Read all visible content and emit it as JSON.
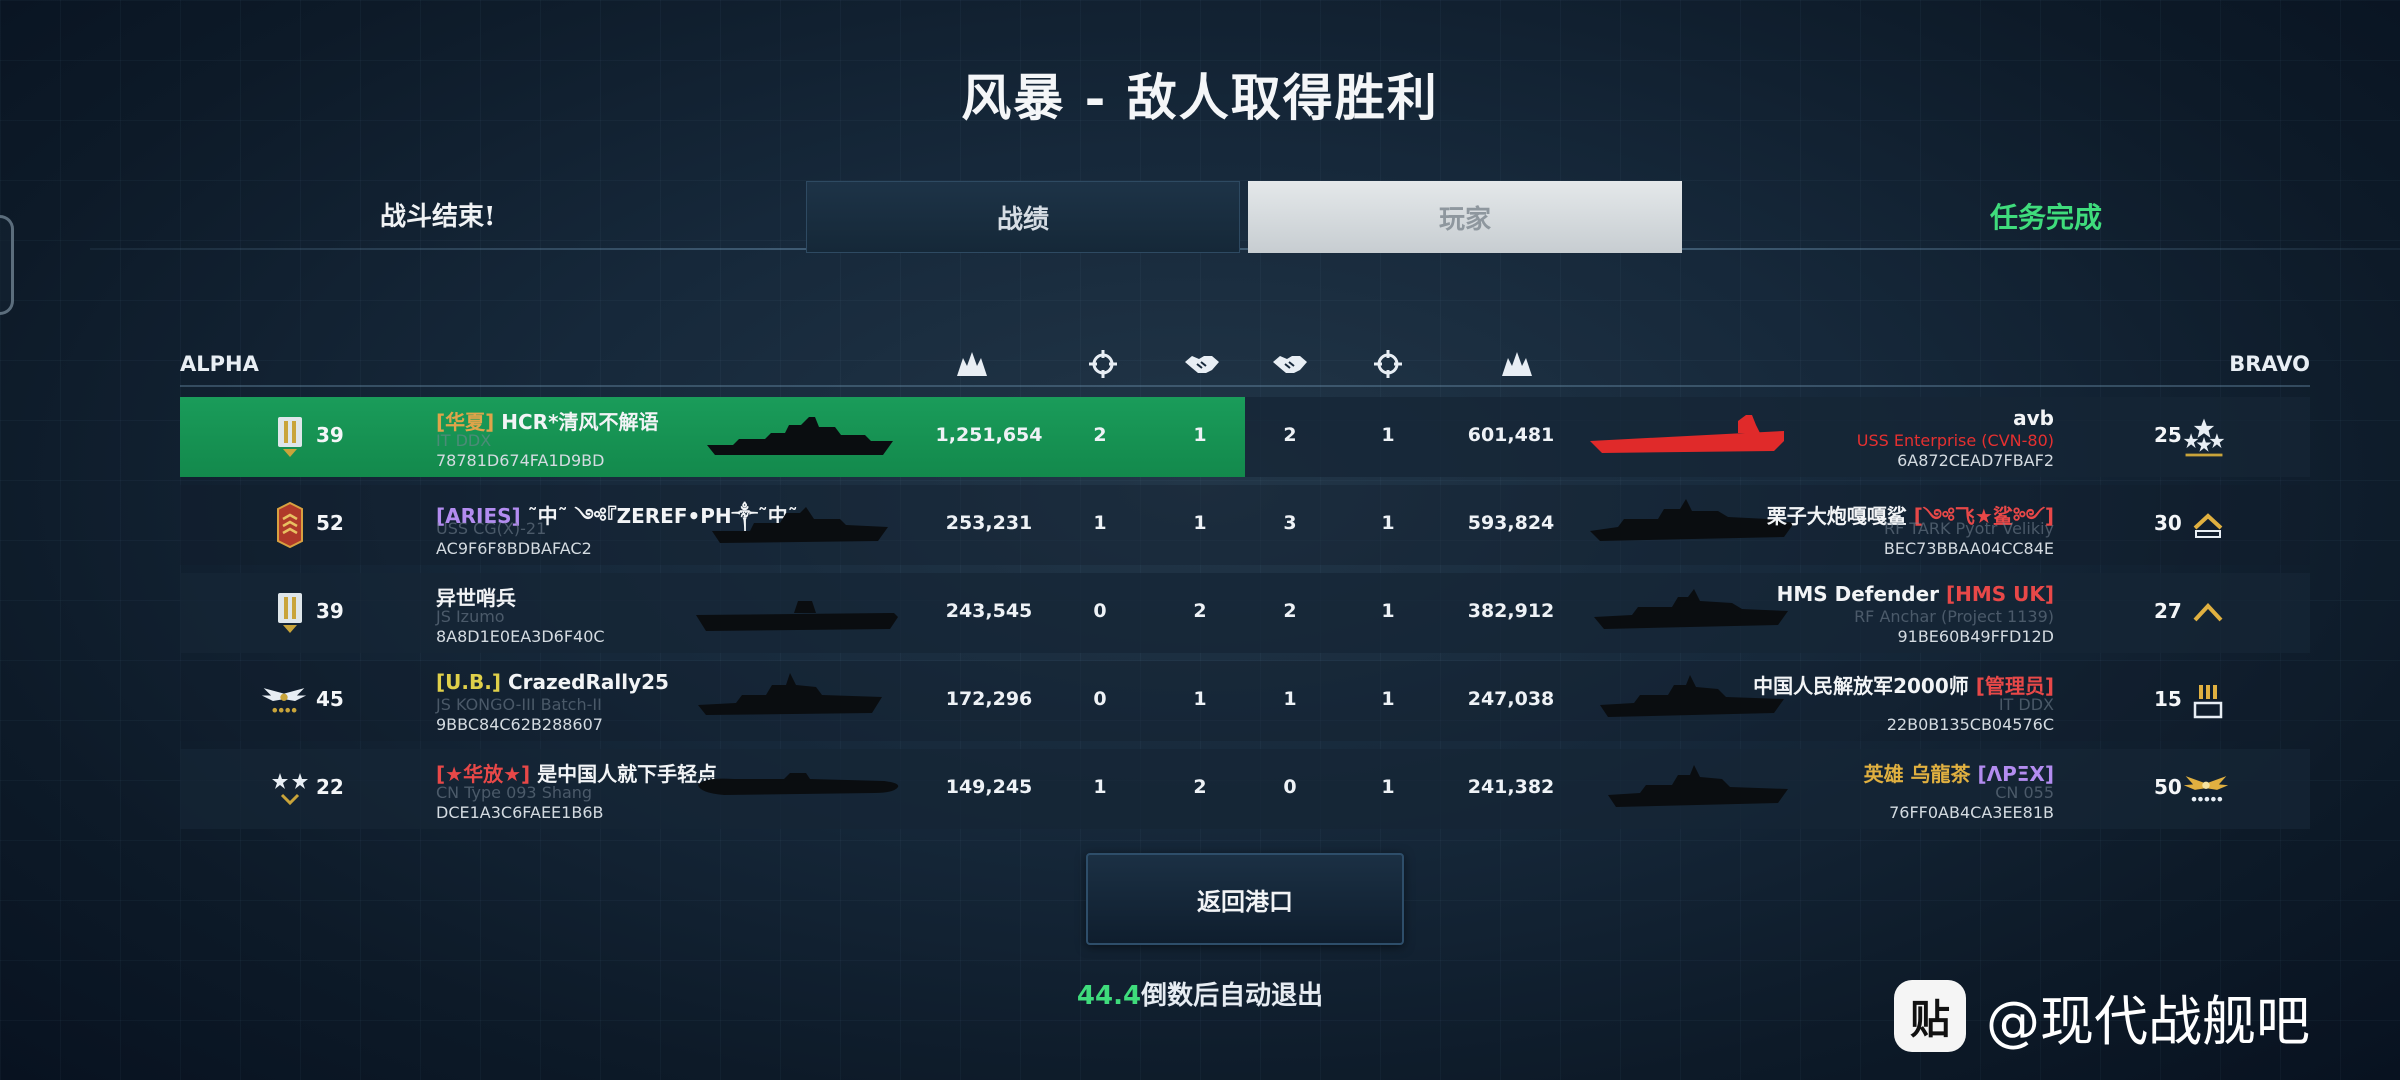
{
  "title": "风暴 - 敌人取得胜利",
  "battle_end": "战斗结束!",
  "mission_complete": "任务完成",
  "tabs": [
    {
      "label": "战绩",
      "active": false
    },
    {
      "label": "玩家",
      "active": true
    }
  ],
  "teams": {
    "left": "ALPHA",
    "right": "BRAVO"
  },
  "column_icons": [
    "damage-icon",
    "crosshair-icon",
    "handshake-icon",
    "handshake-icon",
    "crosshair-icon",
    "damage-icon"
  ],
  "alpha": [
    {
      "rank_icon": "officer-rank-icon",
      "level": "39",
      "tag": "[华夏]",
      "tag_color": "#e0a44a",
      "name": "HCR*清风不解语",
      "ship": "IT DDX",
      "id": "78781D674FA1D9BD",
      "damage": "1,251,654",
      "kills": "2",
      "assists": "1",
      "highlight": true
    },
    {
      "rank_icon": "red-medal-rank-icon",
      "level": "52",
      "tag": "[ARIES]",
      "tag_color": "#b38cf0",
      "name": " ˜中˜ ༺『ZEREF•PH༒˜中˜",
      "ship": "USS CG(X)-21",
      "id": "AC9F6F8BDBAFAC2",
      "damage": "253,231",
      "kills": "1",
      "assists": "1",
      "highlight": false
    },
    {
      "rank_icon": "officer-rank-icon",
      "level": "39",
      "tag": "",
      "tag_color": "#ffffff",
      "name": "异世哨兵",
      "ship": "JS Izumo",
      "id": "8A8D1E0EA3D6F40C",
      "damage": "243,545",
      "kills": "0",
      "assists": "2",
      "highlight": false
    },
    {
      "rank_icon": "winged-eagle-rank-icon",
      "level": "45",
      "tag": "[U.B.]",
      "tag_color": "#e0d04a",
      "name": "CrazedRally25",
      "ship": "JS KONGO-III Batch-II",
      "id": "9BBC84C62B288607",
      "damage": "172,296",
      "kills": "0",
      "assists": "1",
      "highlight": false
    },
    {
      "rank_icon": "two-stars-rank-icon",
      "level": "22",
      "tag": "[★华放★]",
      "tag_color": "#e84848",
      "name": "是中国人就下手轻点",
      "ship": "CN Type 093 Shang",
      "id": "DCE1A3C6FAEE1B6B",
      "damage": "149,245",
      "kills": "1",
      "assists": "2",
      "highlight": false
    }
  ],
  "bravo": [
    {
      "rank_icon": "four-stars-rank-icon",
      "level": "25",
      "tag": "",
      "tag_color": "#ffffff",
      "name": "avb",
      "ship": "USS Enterprise (CVN-80)",
      "ship_color": "#e53030",
      "id": "6A872CEAD7FBAF2",
      "damage": "601,481",
      "kills": "1",
      "assists": "2"
    },
    {
      "rank_icon": "chevron-gold-rank-icon",
      "level": "30",
      "tag": "[༺飞★鲨༻]",
      "tag_color": "#e84848",
      "name": "栗子大炮嘎嘎鲨",
      "ship": "RF TARK Pyotr Velikiy",
      "ship_color": "#6a7a88",
      "id": "BEC73BBAA04CC84E",
      "damage": "593,824",
      "kills": "1",
      "assists": "3"
    },
    {
      "rank_icon": "chevron-single-rank-icon",
      "level": "27",
      "tag": "[HMS UK]",
      "tag_color": "#e84848",
      "name": "HMS Defender",
      "ship": "RF Anchar (Project 1139)",
      "ship_color": "#6a7a88",
      "id": "91BE60B49FFD12D",
      "damage": "382,912",
      "kills": "1",
      "assists": "2"
    },
    {
      "rank_icon": "triple-bar-rank-icon",
      "level": "15",
      "tag": "[管理员]",
      "tag_color": "#e84848",
      "name": "中国人民解放军2000师",
      "ship": "IT DDX",
      "ship_color": "#6a7a88",
      "id": "22B0B135CB04576C",
      "damage": "247,038",
      "kills": "1",
      "assists": "1"
    },
    {
      "rank_icon": "gold-eagle-rank-icon",
      "level": "50",
      "tag": "[ΛPΞX]",
      "tag_color": "#b38cf0",
      "name": "英雄 乌龍茶",
      "name_color": "#e0b040",
      "ship": "CN 055",
      "ship_color": "#6a7a88",
      "id": "76FF0AB4CA3EE81B",
      "damage": "241,382",
      "kills": "1",
      "assists": "0"
    }
  ],
  "back_button": "返回港口",
  "countdown": {
    "seconds": "44.4",
    "text": "倒数后自动退出"
  },
  "watermark": {
    "logo": "贴",
    "text": "@现代战舰吧"
  },
  "colors": {
    "highlight": "#18955a",
    "accent_green": "#3fdc7c",
    "enemy_ship_red": "#e53030"
  }
}
